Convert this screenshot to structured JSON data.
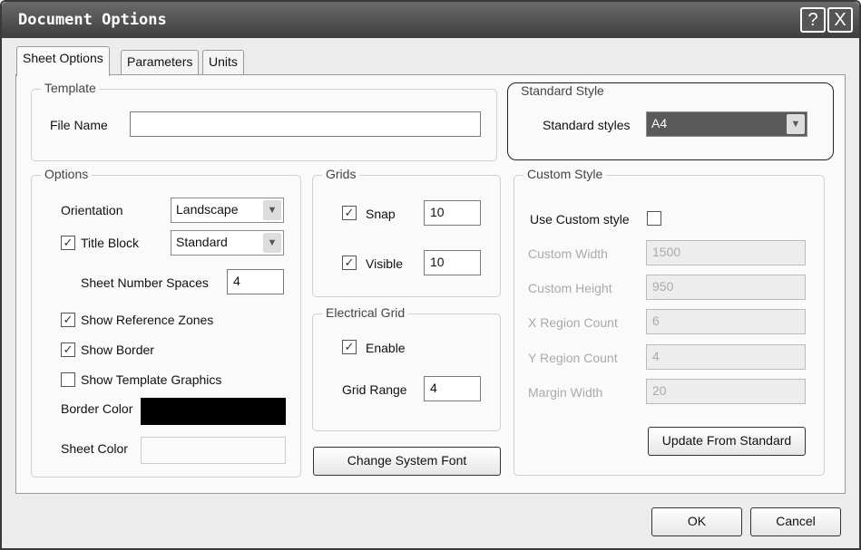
{
  "window": {
    "title": "Document Options",
    "help_label": "?",
    "close_label": "X"
  },
  "tabs": [
    {
      "label": "Sheet Options"
    },
    {
      "label": "Parameters"
    },
    {
      "label": "Units"
    }
  ],
  "template": {
    "legend": "Template",
    "file_name_label": "File Name",
    "file_name_value": ""
  },
  "standard_style": {
    "legend": "Standard Style",
    "label": "Standard styles",
    "value": "A4"
  },
  "options": {
    "legend": "Options",
    "orientation_label": "Orientation",
    "orientation_value": "Landscape",
    "title_block_label": "Title Block",
    "title_block_checked": true,
    "title_block_value": "Standard",
    "sheet_number_label": "Sheet Number Spaces",
    "sheet_number_value": "4",
    "show_ref_zones": "Show Reference Zones",
    "show_ref_zones_checked": true,
    "show_border": "Show Border",
    "show_border_checked": true,
    "show_template": "Show Template Graphics",
    "show_template_checked": false,
    "border_color_label": "Border Color",
    "border_color": "#000000",
    "sheet_color_label": "Sheet Color",
    "sheet_color": "#fafafa"
  },
  "grids": {
    "legend": "Grids",
    "snap_label": "Snap",
    "snap_checked": true,
    "snap_value": "10",
    "visible_label": "Visible",
    "visible_checked": true,
    "visible_value": "10"
  },
  "electrical_grid": {
    "legend": "Electrical Grid",
    "enable_label": "Enable",
    "enable_checked": true,
    "range_label": "Grid Range",
    "range_value": "4"
  },
  "change_font_label": "Change System Font",
  "custom_style": {
    "legend": "Custom Style",
    "use_label": "Use Custom style",
    "use_checked": false,
    "fields": [
      {
        "label": "Custom Width",
        "value": "1500"
      },
      {
        "label": "Custom Height",
        "value": "950"
      },
      {
        "label": "X Region Count",
        "value": "6"
      },
      {
        "label": "Y Region Count",
        "value": "4"
      },
      {
        "label": "Margin Width",
        "value": "20"
      }
    ],
    "update_label": "Update From Standard"
  },
  "ok_label": "OK",
  "cancel_label": "Cancel"
}
